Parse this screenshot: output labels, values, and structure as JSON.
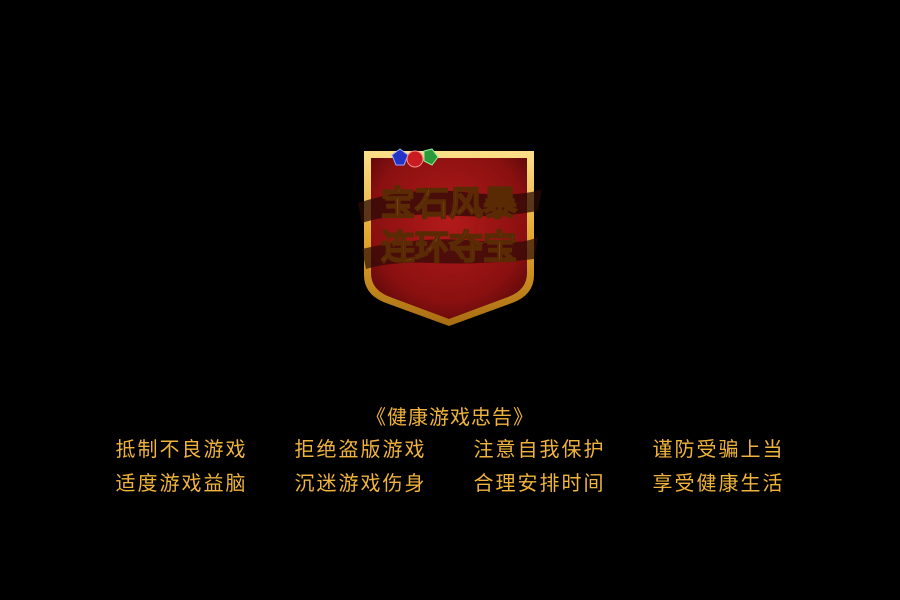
{
  "logo": {
    "line1": "宝石风暴",
    "line2": "连环夺宝",
    "colors": {
      "shield_red": "#9c1414",
      "shield_dark_red": "#5e0909",
      "border_gold": "#e8b23a",
      "text_gold": "#f4c54a"
    }
  },
  "advisory": {
    "title": "《健康游戏忠告》",
    "rows": [
      [
        "抵制不良游戏",
        "拒绝盗版游戏",
        "注意自我保护",
        "谨防受骗上当"
      ],
      [
        "适度游戏益脑",
        "沉迷游戏伤身",
        "合理安排时间",
        "享受健康生活"
      ]
    ],
    "text_color": "#f0b33c"
  }
}
